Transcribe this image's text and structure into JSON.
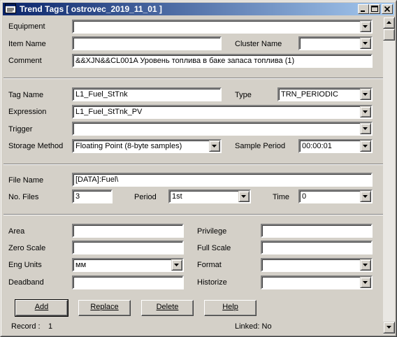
{
  "window": {
    "title": "Trend Tags [ ostrovec_2019_11_01 ]"
  },
  "section1": {
    "equipment_label": "Equipment",
    "equipment_value": "",
    "item_name_label": "Item Name",
    "item_name_value": "",
    "cluster_name_label": "Cluster Name",
    "cluster_name_value": "",
    "comment_label": "Comment",
    "comment_value": "&&XJN&&CL001A Уровень топлива в баке запаса топлива (1)"
  },
  "section2": {
    "tag_name_label": "Tag Name",
    "tag_name_value": "L1_Fuel_StTnk",
    "type_label": "Type",
    "type_value": "TRN_PERIODIC",
    "expression_label": "Expression",
    "expression_value": "L1_Fuel_StTnk_PV",
    "trigger_label": "Trigger",
    "trigger_value": "",
    "storage_method_label": "Storage Method",
    "storage_method_value": "Floating Point (8-byte samples)",
    "sample_period_label": "Sample Period",
    "sample_period_value": "00:00:01"
  },
  "section3": {
    "file_name_label": "File Name",
    "file_name_value": "[DATA]:Fuel\\",
    "no_files_label": "No. Files",
    "no_files_value": "3",
    "period_label": "Period",
    "period_value": "1st",
    "time_label": "Time",
    "time_value": "0"
  },
  "section4": {
    "area_label": "Area",
    "area_value": "",
    "privilege_label": "Privilege",
    "privilege_value": "",
    "zero_scale_label": "Zero Scale",
    "zero_scale_value": "",
    "full_scale_label": "Full Scale",
    "full_scale_value": "",
    "eng_units_label": "Eng Units",
    "eng_units_value": "мм",
    "format_label": "Format",
    "format_value": "",
    "deadband_label": "Deadband",
    "deadband_value": "",
    "historize_label": "Historize",
    "historize_value": ""
  },
  "buttons": {
    "add": "Add",
    "replace": "Replace",
    "delete": "Delete",
    "help": "Help"
  },
  "status": {
    "record_label": "Record :",
    "record_value": "1",
    "linked": "Linked: No"
  },
  "icons": {
    "app": "app-window-icon",
    "minimize": "minimize-icon",
    "maximize": "maximize-icon",
    "close": "close-icon",
    "dropdown": "chevron-down-icon",
    "scroll_up": "scroll-up-icon",
    "scroll_down": "scroll-down-icon"
  }
}
